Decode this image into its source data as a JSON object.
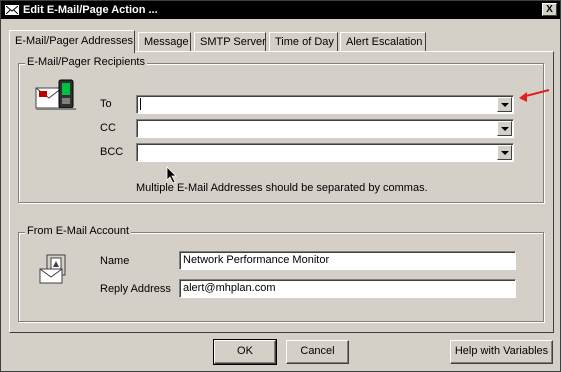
{
  "window": {
    "title": "Edit E-Mail/Page Action ...",
    "close_glyph": "X"
  },
  "tabs": [
    {
      "label": "E-Mail/Pager Addresses",
      "active": true
    },
    {
      "label": "Message",
      "active": false
    },
    {
      "label": "SMTP Server",
      "active": false
    },
    {
      "label": "Time of Day",
      "active": false
    },
    {
      "label": "Alert Escalation",
      "active": false
    }
  ],
  "recipients": {
    "legend": "E-Mail/Pager Recipients",
    "to_label": "To",
    "to_value": "",
    "cc_label": "CC",
    "cc_value": "",
    "bcc_label": "BCC",
    "bcc_value": "",
    "hint": "Multiple E-Mail Addresses should be separated by commas.",
    "icon": "email-pager-icon"
  },
  "from_account": {
    "legend": "From E-Mail Account",
    "name_label": "Name",
    "name_value": "Network Performance Monitor",
    "reply_label": "Reply Address",
    "reply_value": "alert@mhplan.com",
    "icon": "email-account-icon"
  },
  "buttons": {
    "ok": "OK",
    "cancel": "Cancel",
    "help": "Help with Variables"
  },
  "colors": {
    "dialog_bg": "#d4d0c8",
    "annotation_arrow": "#e02020"
  }
}
